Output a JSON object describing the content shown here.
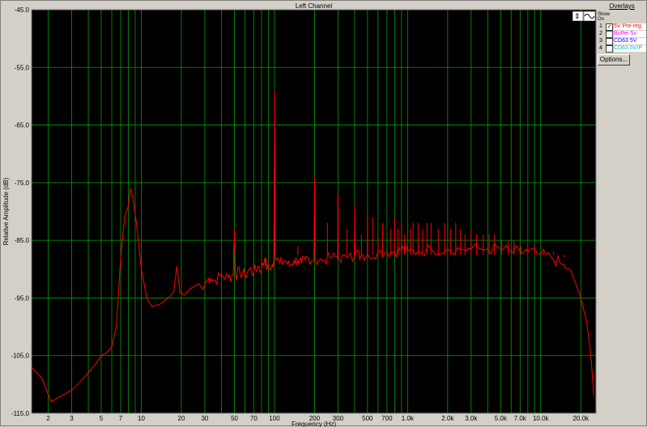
{
  "chart_data": {
    "type": "line",
    "title": "Left Channel",
    "xlabel": "Frequency (Hz)",
    "ylabel": "Relative Amplitude (dB)",
    "x_scale": "log",
    "xlim": [
      1.5,
      26000
    ],
    "ylim": [
      -115,
      -45
    ],
    "yticks": [
      "-45.0",
      "-55.0",
      "-65.0",
      "-75.0",
      "-85.0",
      "-95.0",
      "-105.0",
      "-115.0"
    ],
    "xticks": [
      {
        "v": 2,
        "label": "2"
      },
      {
        "v": 3,
        "label": "3"
      },
      {
        "v": 5,
        "label": "5"
      },
      {
        "v": 7,
        "label": "7"
      },
      {
        "v": 10,
        "label": "10"
      },
      {
        "v": 20,
        "label": "20"
      },
      {
        "v": 30,
        "label": "30"
      },
      {
        "v": 50,
        "label": "50"
      },
      {
        "v": 70,
        "label": "70"
      },
      {
        "v": 100,
        "label": "100"
      },
      {
        "v": 200,
        "label": "200"
      },
      {
        "v": 300,
        "label": "300"
      },
      {
        "v": 500,
        "label": "500"
      },
      {
        "v": 700,
        "label": "700"
      },
      {
        "v": 1000,
        "label": "1.0k"
      },
      {
        "v": 2000,
        "label": "2.0k"
      },
      {
        "v": 3000,
        "label": "3.0k"
      },
      {
        "v": 5000,
        "label": "5.0k"
      },
      {
        "v": 7000,
        "label": "7.0k"
      },
      {
        "v": 10000,
        "label": "10.0k"
      },
      {
        "v": 20000,
        "label": "20.0k"
      }
    ],
    "grid": true,
    "series": [
      {
        "name": "5V Pre-reg",
        "color": "#ff0000",
        "points": [
          [
            1.5,
            -107
          ],
          [
            1.8,
            -109
          ],
          [
            2.1,
            -113
          ],
          [
            2.5,
            -112
          ],
          [
            3.0,
            -111
          ],
          [
            3.5,
            -109.5
          ],
          [
            4.0,
            -108
          ],
          [
            4.5,
            -106.5
          ],
          [
            5.0,
            -105
          ],
          [
            5.5,
            -104.5
          ],
          [
            6.0,
            -103.5
          ],
          [
            6.5,
            -100
          ],
          [
            7.0,
            -88
          ],
          [
            7.5,
            -81
          ],
          [
            8.0,
            -79
          ],
          [
            8.3,
            -76
          ],
          [
            8.7,
            -78
          ],
          [
            9.2,
            -82
          ],
          [
            10.0,
            -90
          ],
          [
            11.0,
            -95
          ],
          [
            12.0,
            -96.5
          ],
          [
            14.0,
            -96
          ],
          [
            16.0,
            -95
          ],
          [
            17.5,
            -94
          ],
          [
            18.5,
            -89.5
          ],
          [
            19.5,
            -94
          ],
          [
            21.0,
            -94.5
          ],
          [
            23.0,
            -93.5
          ],
          [
            25.0,
            -93
          ],
          [
            27.0,
            -92.5
          ],
          [
            29.0,
            -93.5
          ],
          [
            31.0,
            -92
          ],
          [
            33.0,
            -91.5
          ],
          [
            36.0,
            -92
          ],
          [
            40.0,
            -91
          ],
          [
            45.0,
            -91.5
          ],
          [
            49.0,
            -91
          ],
          [
            50.0,
            -83
          ],
          [
            51.0,
            -91
          ],
          [
            55.0,
            -90.5
          ],
          [
            60.0,
            -91
          ],
          [
            65.0,
            -90
          ],
          [
            70.0,
            -90.5
          ],
          [
            75.0,
            -89.5
          ],
          [
            80.0,
            -90
          ],
          [
            85.0,
            -88
          ],
          [
            88.0,
            -90
          ],
          [
            95.0,
            -89.5
          ],
          [
            99.0,
            -89.5
          ],
          [
            100.0,
            -59
          ],
          [
            101.0,
            -88
          ],
          [
            110.0,
            -89
          ],
          [
            120.0,
            -88.5
          ],
          [
            130.0,
            -89.5
          ],
          [
            140.0,
            -88.5
          ],
          [
            150.0,
            -88.5
          ],
          [
            160.0,
            -89
          ],
          [
            170.0,
            -88.5
          ],
          [
            180.0,
            -88
          ],
          [
            198.0,
            -88.5
          ],
          [
            200.0,
            -74
          ],
          [
            202.0,
            -88
          ],
          [
            230.0,
            -88.5
          ],
          [
            260.0,
            -88
          ],
          [
            298.0,
            -88
          ],
          [
            300.0,
            -77
          ],
          [
            302.0,
            -88
          ],
          [
            350.0,
            -88
          ],
          [
            398.0,
            -88
          ],
          [
            400.0,
            -79
          ],
          [
            402.0,
            -87.5
          ],
          [
            450.0,
            -87.5
          ],
          [
            498.0,
            -87.5
          ],
          [
            500.0,
            -80
          ],
          [
            502.0,
            -87.5
          ],
          [
            600.0,
            -87
          ],
          [
            700.0,
            -87
          ],
          [
            800.0,
            -87
          ],
          [
            900.0,
            -86.5
          ],
          [
            1000.0,
            -87
          ],
          [
            1200.0,
            -87
          ],
          [
            1500.0,
            -86.5
          ],
          [
            2000.0,
            -86.5
          ],
          [
            2500.0,
            -86.5
          ],
          [
            3000.0,
            -86.5
          ],
          [
            4000.0,
            -86.5
          ],
          [
            5000.0,
            -86.5
          ],
          [
            6000.0,
            -87
          ],
          [
            7000.0,
            -87
          ],
          [
            8000.0,
            -87
          ],
          [
            10000.0,
            -87.5
          ],
          [
            12000.0,
            -88
          ],
          [
            14000.0,
            -89
          ],
          [
            16000.0,
            -90
          ],
          [
            18000.0,
            -92
          ],
          [
            20000.0,
            -95
          ],
          [
            21000.0,
            -97
          ],
          [
            22000.0,
            -99
          ],
          [
            23000.0,
            -102
          ],
          [
            24000.0,
            -106
          ],
          [
            25000.0,
            -112
          ]
        ],
        "spikes": [
          [
            150.0,
            -86
          ],
          [
            250.0,
            -82
          ],
          [
            350.0,
            -83
          ],
          [
            450.0,
            -84
          ],
          [
            550.0,
            -81
          ],
          [
            600.0,
            -84
          ],
          [
            650.0,
            -82
          ],
          [
            750.0,
            -83
          ],
          [
            800.0,
            -81
          ],
          [
            850.0,
            -83
          ],
          [
            900.0,
            -82
          ],
          [
            950.0,
            -84
          ],
          [
            1050.0,
            -83
          ],
          [
            1100.0,
            -82
          ],
          [
            1200.0,
            -82
          ],
          [
            1300.0,
            -83
          ],
          [
            1400.0,
            -82
          ],
          [
            1500.0,
            -82
          ],
          [
            1700.0,
            -83
          ],
          [
            1900.0,
            -82
          ],
          [
            2100.0,
            -83
          ],
          [
            2300.0,
            -82
          ],
          [
            2500.0,
            -83
          ],
          [
            2700.0,
            -84
          ],
          [
            3000.0,
            -83
          ],
          [
            3300.0,
            -84
          ],
          [
            3700.0,
            -84
          ],
          [
            4100.0,
            -84
          ],
          [
            4500.0,
            -84
          ],
          [
            5100.0,
            -85
          ],
          [
            5700.0,
            -85
          ],
          [
            6300.0,
            -85
          ],
          [
            7100.0,
            -86
          ],
          [
            8000.0,
            -86
          ],
          [
            9000.0,
            -86
          ],
          [
            10500.0,
            -87
          ],
          [
            12500.0,
            -87
          ],
          [
            15000.0,
            -88
          ]
        ]
      }
    ]
  },
  "overlays": {
    "header": "Overlays",
    "col_header": "Show\nOn",
    "rows": [
      {
        "num": "1",
        "checked": true,
        "label": "5V Pre-reg",
        "color": "#ff0000"
      },
      {
        "num": "2",
        "checked": false,
        "label": "Buffer 5v",
        "color": "#ff00ff"
      },
      {
        "num": "3",
        "checked": false,
        "label": "CD63 5V",
        "color": "#0000ff"
      },
      {
        "num": "4",
        "checked": false,
        "label": "CD63 5V/P",
        "color": "#00c0c0"
      }
    ],
    "options_label": "Options..."
  },
  "icons": [
    "cursor-icon",
    "waveform-icon"
  ],
  "colors": {
    "plot_bg": "#000000",
    "grid": "#00a000",
    "frame": "#d4d0c8"
  }
}
